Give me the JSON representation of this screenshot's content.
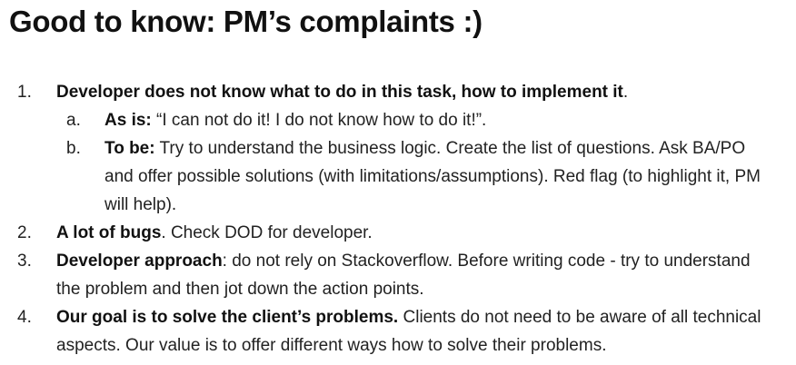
{
  "title": "Good to know: PM’s complaints :)",
  "items": [
    {
      "num": "1.",
      "bold": "Developer does not know what to do in this task, how to implement it",
      "rest": ".",
      "subitems": [
        {
          "letter": "a.",
          "bold": "As is:",
          "rest": " “I can not do it! I do not know how to do it!”."
        },
        {
          "letter": "b.",
          "bold": "To be:",
          "rest": " Try to understand the business logic. Create the list of questions. Ask BA/PO and offer possible solutions (with limitations/assumptions). Red flag (to highlight it, PM will help)."
        }
      ]
    },
    {
      "num": "2.",
      "bold": " A lot of bugs",
      "rest": ". Check DOD for developer."
    },
    {
      "num": "3.",
      "bold": "Developer approach",
      "rest": ": do not rely on Stackoverflow. Before writing code - try to understand the problem and then jot down the action points."
    },
    {
      "num": "4.",
      "bold": "Our goal is to solve the client’s problems.",
      "rest": " Clients do not need to be aware of all technical aspects. Our value is to offer different ways how to solve their problems."
    }
  ]
}
